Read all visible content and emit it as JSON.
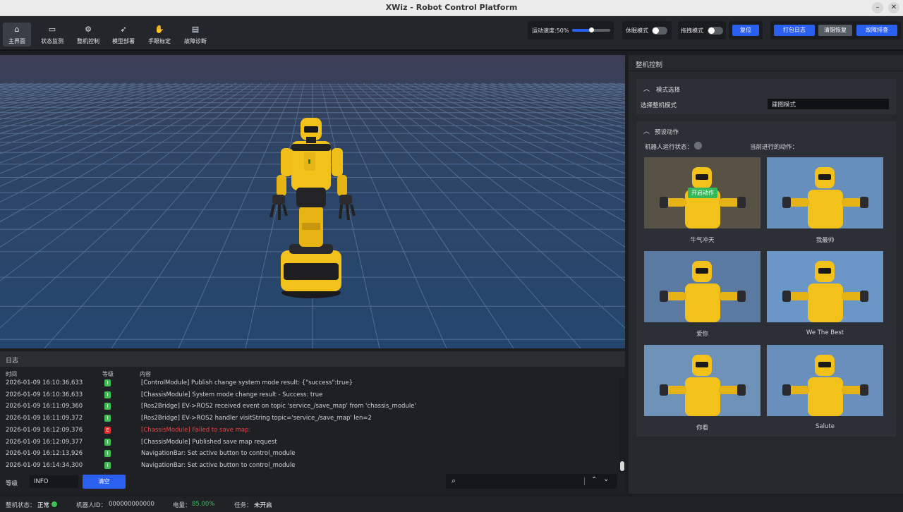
{
  "window": {
    "title": "XWiz - Robot Control Platform",
    "minimize": "–",
    "close": "✕"
  },
  "nav": [
    {
      "label": "主界面",
      "icon": "home-icon",
      "glyph": "⌂"
    },
    {
      "label": "状态监测",
      "icon": "monitor-icon",
      "glyph": "▭"
    },
    {
      "label": "整机控制",
      "icon": "robot-control-icon",
      "glyph": "⚙"
    },
    {
      "label": "模型部署",
      "icon": "rocket-icon",
      "glyph": "➶"
    },
    {
      "label": "手眼标定",
      "icon": "hand-eye-icon",
      "glyph": "✋"
    },
    {
      "label": "故障诊断",
      "icon": "diagnosis-icon",
      "glyph": "▤"
    }
  ],
  "toolbar": {
    "speed_label": "运动速度:50%",
    "speed_value": 0.5,
    "sleep_label": "休眠模式",
    "drag_label": "拖拽模式",
    "reset_label": "复位",
    "pack_log_label": "打包日志",
    "clear_error_label": "清错恢复",
    "troubleshoot_label": "故障排查"
  },
  "log": {
    "title": "日志",
    "col_time": "时间",
    "col_level": "等级",
    "col_content": "内容",
    "rows": [
      {
        "time": "2026-01-09 16:10:36,633",
        "level": "I",
        "msg": "[ControlModule] Publish change system mode result: {\"success\":true}"
      },
      {
        "time": "2026-01-09 16:10:36,633",
        "level": "I",
        "msg": "[ChassisModule] System mode change result - Success: true"
      },
      {
        "time": "2026-01-09 16:11:09,360",
        "level": "I",
        "msg": "[Ros2Bridge] EV->ROS2 received event on topic 'service_/save_map' from 'chassis_module'"
      },
      {
        "time": "2026-01-09 16:11:09,372",
        "level": "I",
        "msg": "[Ros2Bridge] EV->ROS2 handler visitString topic='service_/save_map' len=2"
      },
      {
        "time": "2026-01-09 16:12:09,376",
        "level": "E",
        "msg": "[ChassisModule] Failed to save map:"
      },
      {
        "time": "2026-01-09 16:12:09,377",
        "level": "I",
        "msg": "[ChassisModule] Published save map request"
      },
      {
        "time": "2026-01-09 16:12:13,926",
        "level": "I",
        "msg": "NavigationBar: Set active button to control_module"
      },
      {
        "time": "2026-01-09 16:14:34,300",
        "level": "I",
        "msg": "NavigationBar: Set active button to control_module"
      }
    ],
    "level_label": "等级",
    "level_value": "INFO",
    "clear_label": "清空",
    "search_placeholder": ""
  },
  "panel": {
    "title": "整机控制",
    "mode_section": "模式选择",
    "mode_label": "选择整机模式",
    "mode_value": "建图模式",
    "preset_section": "预设动作",
    "run_state_label": "机器人运行状态：",
    "current_action_label": "当前进行的动作：",
    "start_action_label": "开启动作",
    "actions": [
      "牛气冲天",
      "我最帅",
      "爱你",
      "We The Best",
      "你看",
      "Salute"
    ]
  },
  "statusbar": {
    "state_label": "整机状态：",
    "state_value": "正常",
    "robot_id_label": "机器人ID：",
    "robot_id_value": "000000000000",
    "battery_label": "电量：",
    "battery_value": "85.00%",
    "task_label": "任务：",
    "task_value": "未开启"
  },
  "colors": {
    "accent": "#2b5ff0",
    "ok": "#3fbf52",
    "error": "#e02f2f",
    "battery": "#35c05a",
    "robot": "#f2c21b"
  }
}
